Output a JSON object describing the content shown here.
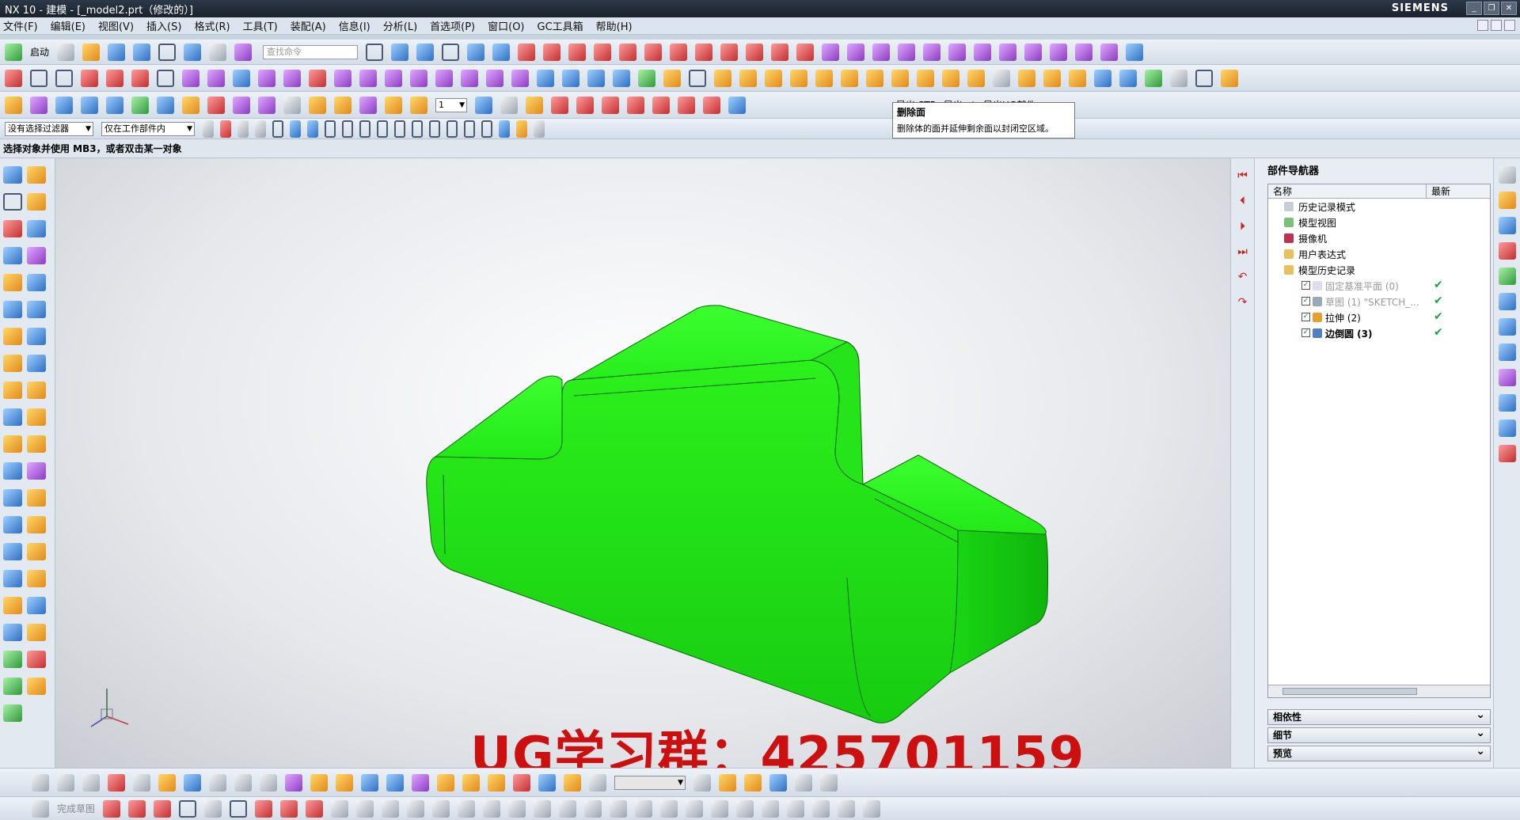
{
  "window": {
    "title": "NX 10 - 建模 - [_model2.prt（修改的）]",
    "brand": "SIEMENS",
    "min": "_",
    "restore": "❐",
    "close": "✕"
  },
  "menu": [
    "文件(F)",
    "编辑(E)",
    "视图(V)",
    "插入(S)",
    "格式(R)",
    "工具(T)",
    "装配(A)",
    "信息(I)",
    "分析(L)",
    "首选项(P)",
    "窗口(O)",
    "GC工具箱",
    "帮助(H)"
  ],
  "toolbar": {
    "start_label": "启动",
    "search_placeholder": "查找命令",
    "export_stp": "导出 STP",
    "export_xt": "导出x-t",
    "export_ug": "导出UG部件",
    "layer_value": "1"
  },
  "selection": {
    "filter": "没有选择过滤器",
    "scope": "仅在工作部件内"
  },
  "cue_line": "选择对象并使用 MB3，或者双击某一对象",
  "tooltip": {
    "title": "删除面",
    "description": "删除体的面并延伸剩余面以封闭空区域。"
  },
  "navigator": {
    "title": "部件导航器",
    "col_name": "名称",
    "col_latest": "最新",
    "items": [
      {
        "label": "历史记录模式"
      },
      {
        "label": "模型视图"
      },
      {
        "label": "摄像机"
      },
      {
        "label": "用户表达式"
      },
      {
        "label": "模型历史记录"
      },
      {
        "label": "固定基准平面 (0)"
      },
      {
        "label": "草图 (1) \"SKETCH_..."
      },
      {
        "label": "拉伸 (2)"
      },
      {
        "label": "边倒圆 (3)"
      }
    ],
    "sections": [
      "相依性",
      "细节",
      "预览"
    ]
  },
  "watermark": "UG学习群：425701159",
  "bottom": {
    "finish_sketch": "完成草图"
  },
  "colors": {
    "model": "#22ee1a",
    "accent": "#cc1010"
  }
}
